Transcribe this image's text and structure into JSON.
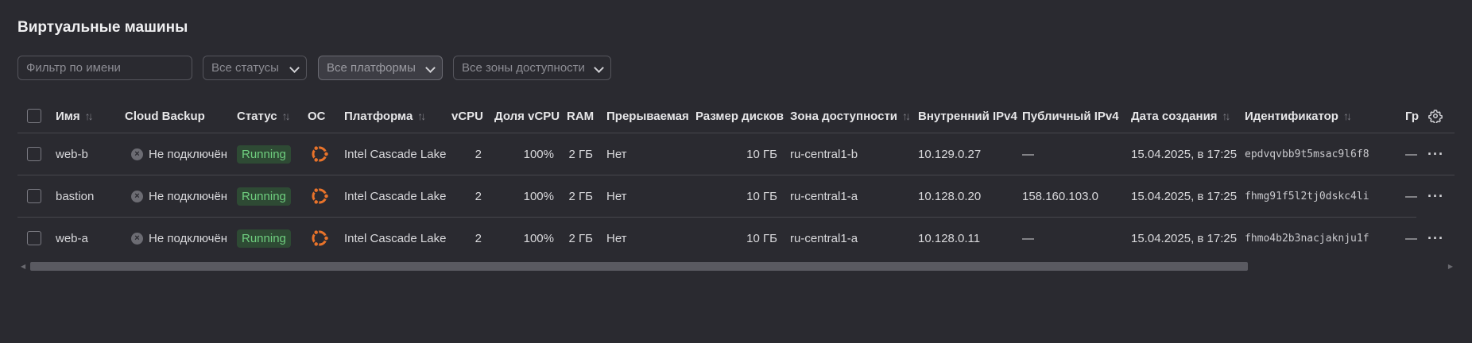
{
  "page": {
    "title": "Виртуальные машины"
  },
  "filters": {
    "name_placeholder": "Фильтр по имени",
    "status": "Все статусы",
    "platform": "Все платформы",
    "zone": "Все зоны доступности"
  },
  "columns": {
    "name": "Имя",
    "backup": "Cloud Backup",
    "status": "Статус",
    "os": "ОС",
    "platform": "Платформа",
    "vcpu": "vCPU",
    "cpu_share": "Доля vCPU",
    "ram": "RAM",
    "preemptible": "Прерываемая",
    "disk_size": "Размер дисков",
    "zone": "Зона доступности",
    "internal_ip": "Внутренний IPv4",
    "public_ip": "Публичный IPv4",
    "created": "Дата создания",
    "id": "Идентификатор",
    "group": "Гр"
  },
  "sort_glyph": "↑↓",
  "rows": [
    {
      "name": "web-b",
      "backup": "Не подключён",
      "status": "Running",
      "os_icon": "ubuntu-icon",
      "platform": "Intel Cascade Lake",
      "vcpu": "2",
      "cpu_share": "100%",
      "ram": "2 ГБ",
      "preemptible": "Нет",
      "disk_size": "10 ГБ",
      "zone": "ru-central1-b",
      "internal_ip": "10.129.0.27",
      "public_ip": "—",
      "created": "15.04.2025, в 17:25",
      "id": "epdvqvbb9t5msac9l6f8",
      "group": "—"
    },
    {
      "name": "bastion",
      "backup": "Не подключён",
      "status": "Running",
      "os_icon": "ubuntu-icon",
      "platform": "Intel Cascade Lake",
      "vcpu": "2",
      "cpu_share": "100%",
      "ram": "2 ГБ",
      "preemptible": "Нет",
      "disk_size": "10 ГБ",
      "zone": "ru-central1-a",
      "internal_ip": "10.128.0.20",
      "public_ip": "158.160.103.0",
      "created": "15.04.2025, в 17:25",
      "id": "fhmg91f5l2tj0dskc4li",
      "group": "—"
    },
    {
      "name": "web-a",
      "backup": "Не подключён",
      "status": "Running",
      "os_icon": "ubuntu-icon",
      "platform": "Intel Cascade Lake",
      "vcpu": "2",
      "cpu_share": "100%",
      "ram": "2 ГБ",
      "preemptible": "Нет",
      "disk_size": "10 ГБ",
      "zone": "ru-central1-a",
      "internal_ip": "10.128.0.11",
      "public_ip": "—",
      "created": "15.04.2025, в 17:25",
      "id": "fhmo4b2b3nacjaknju1f",
      "group": "—"
    }
  ],
  "icons": {
    "settings": "gear-icon",
    "row_menu": "more-icon",
    "not_connected": "x-circle-icon"
  },
  "colors": {
    "background": "#2a2a30",
    "status_running_bg": "#2e4a34",
    "status_running_text": "#6fcf7f",
    "ubuntu": "#e9732a"
  }
}
